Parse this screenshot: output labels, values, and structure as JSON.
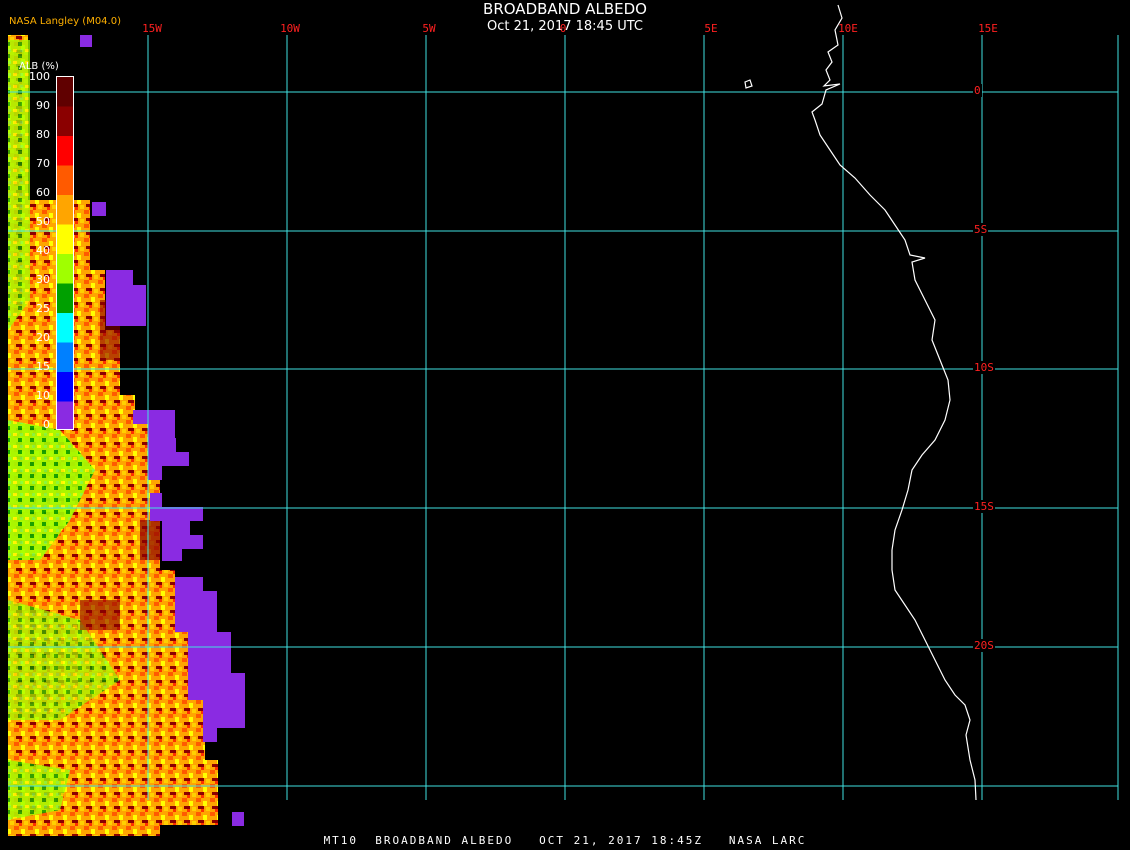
{
  "title": "BROADBAND ALBEDO",
  "subtitle": "Oct 21, 2017 18:45 UTC",
  "credit": "NASA Langley (M04.0)",
  "footer": "MT10  BROADBAND ALBEDO   OCT 21, 2017 18:45Z   NASA LARC",
  "legend": {
    "title": "ALB (%)",
    "ticks": [
      "100",
      "90",
      "80",
      "70",
      "60",
      "50",
      "40",
      "30",
      "25",
      "20",
      "15",
      "10",
      "0"
    ],
    "colors": [
      "#600000",
      "#8b0000",
      "#ff0000",
      "#ff5a00",
      "#ffa500",
      "#ffff00",
      "#a0ff00",
      "#00a000",
      "#006400",
      "#00ffff",
      "#0080ff",
      "#0000ff",
      "#8a2be2"
    ]
  },
  "grid": {
    "longitudes": [
      "15W",
      "10W",
      "5W",
      "0",
      "5E",
      "10E",
      "15E"
    ],
    "latitudes": [
      "0",
      "5S",
      "10S",
      "15S",
      "20S"
    ]
  },
  "colors": {
    "grid": "#40e0e0",
    "label": "#ff2020",
    "coast": "#ffffff",
    "missing": "#8a2be2"
  }
}
